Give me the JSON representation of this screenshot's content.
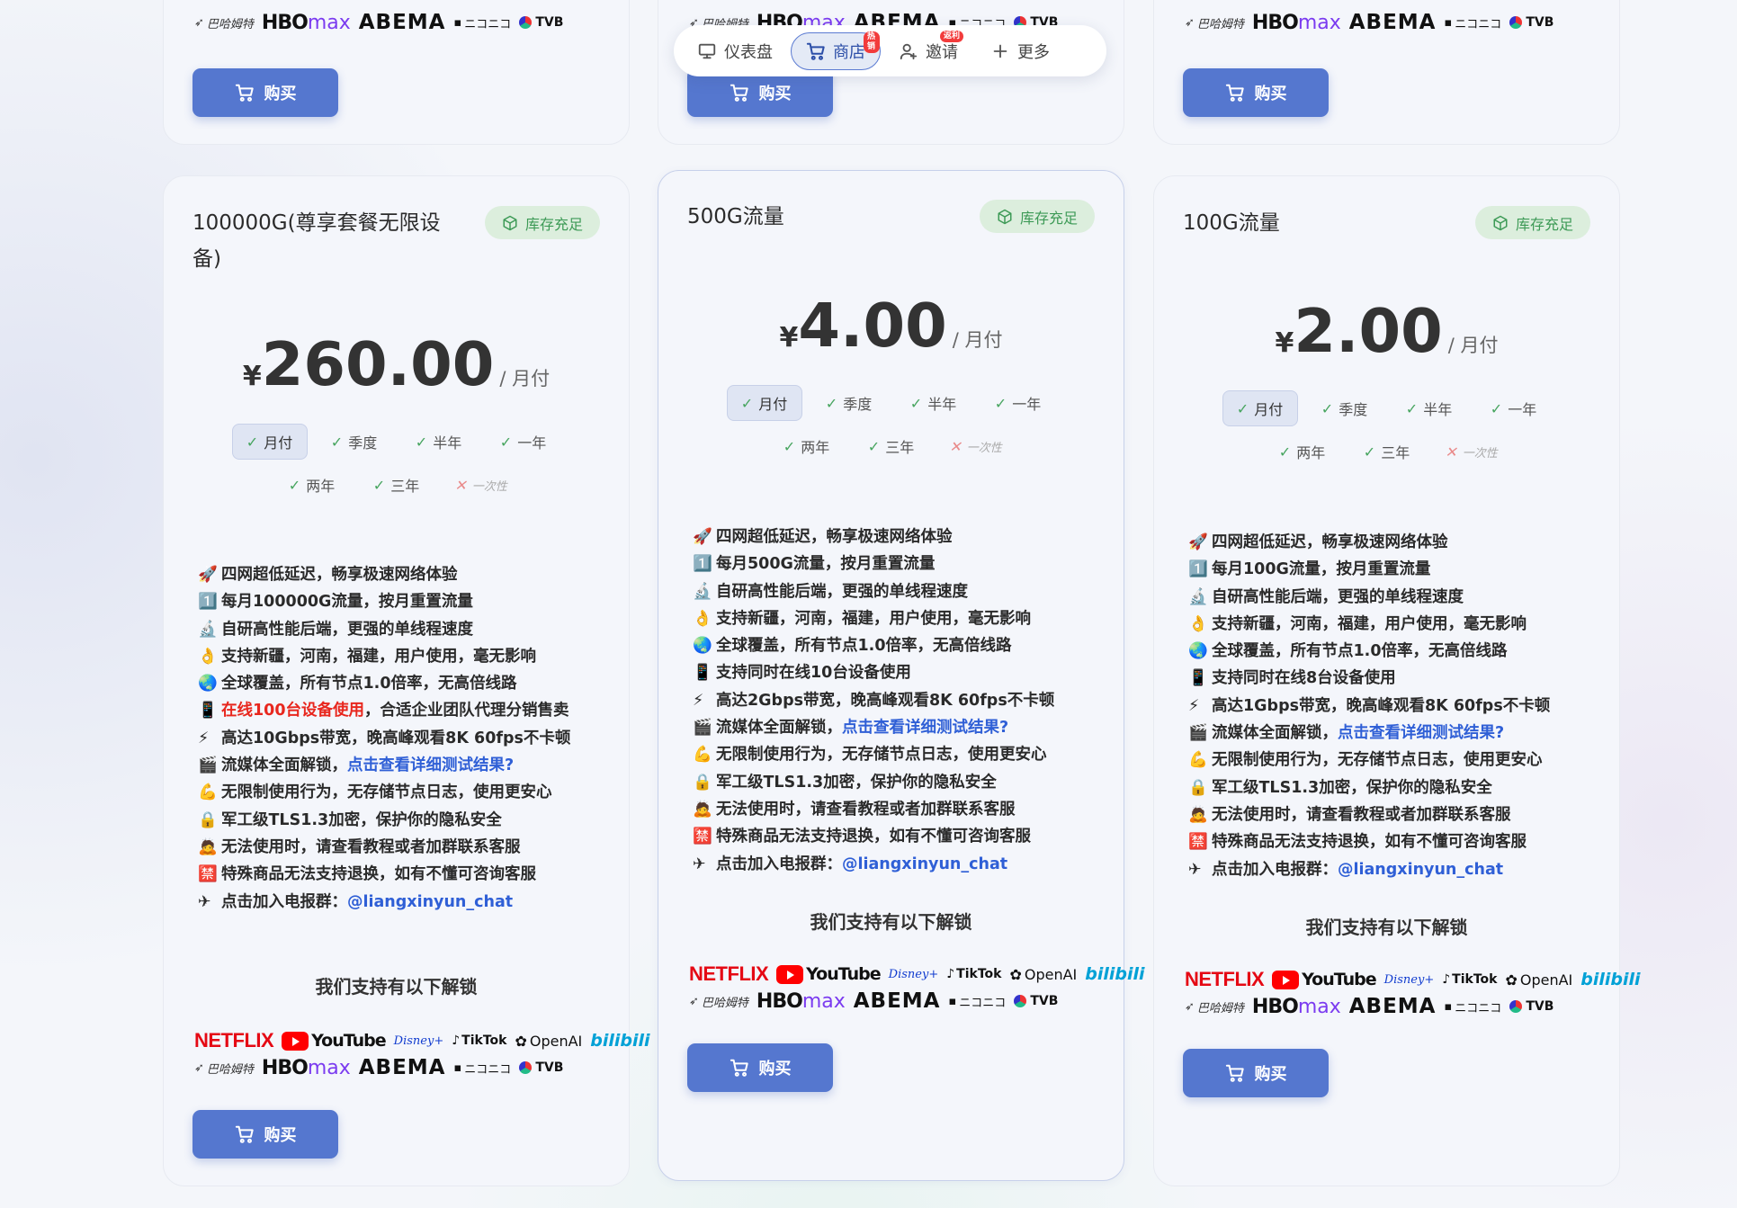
{
  "nav": {
    "items": [
      {
        "label": "仪表盘",
        "icon": "monitor-icon",
        "badge": ""
      },
      {
        "label": "商店",
        "icon": "cart-icon",
        "badge": "热销"
      },
      {
        "label": "邀请",
        "icon": "user-add-icon",
        "badge": "返利"
      },
      {
        "label": "更多",
        "icon": "plus-icon",
        "badge": ""
      }
    ],
    "active": "商店"
  },
  "common": {
    "buy_label": "购买",
    "unlock_title": "我们支持有以下解锁",
    "stock_label": "库存充足",
    "price_currency": "¥",
    "price_period": "/ 月付",
    "cycles": [
      {
        "label": "月付",
        "available": true,
        "selected": true
      },
      {
        "label": "季度",
        "available": true
      },
      {
        "label": "半年",
        "available": true
      },
      {
        "label": "一年",
        "available": true
      },
      {
        "label": "两年",
        "available": true
      },
      {
        "label": "三年",
        "available": true
      },
      {
        "label": "一次性",
        "available": false
      }
    ],
    "logos": {
      "netflix": "NETFLIX",
      "youtube": "YouTube",
      "disney": "Disney+",
      "tiktok": "TikTok",
      "openai": "OpenAI",
      "bilibili": "bilibili",
      "bahamut": "巴哈姆特",
      "hbo": "HBO",
      "max": "max",
      "abema": "ABEMA",
      "niconico": "ニコニコ",
      "tvb": "TVB"
    }
  },
  "plans": [
    {
      "title": "100000G(尊享套餐无限设备)",
      "price": "260.00",
      "features": [
        {
          "icon": "🚀",
          "text": "四网超低延迟，畅享极速网络体验"
        },
        {
          "icon": "1️⃣",
          "text": "每月100000G流量，按月重置流量"
        },
        {
          "icon": "🔬",
          "text": "自研高性能后端，更强的单线程速度"
        },
        {
          "icon": "👌",
          "text": "支持新疆，河南，福建，用户使用，毫无影响"
        },
        {
          "icon": "🌏",
          "text": "全球覆盖，所有节点1.0倍率，无高倍线路"
        },
        {
          "icon": "📱",
          "red": "在线100台设备使用",
          "text": "，合适企业团队代理分销售卖"
        },
        {
          "icon": "⚡",
          "text": "高达10Gbps带宽，晚高峰观看8K 60fps不卡顿"
        },
        {
          "icon": "🎬",
          "text": "流媒体全面解锁，",
          "link": "点击查看详细测试结果?"
        },
        {
          "icon": "💪",
          "text": "无限制使用行为，无存储节点日志，使用更安心"
        },
        {
          "icon": "🔒",
          "text": "军工级TLS1.3加密，保护你的隐私安全"
        },
        {
          "icon": "🙇",
          "text": "无法使用时，请查看教程或者加群联系客服"
        },
        {
          "icon": "🈲",
          "text": "特殊商品无法支持退换，如有不懂可咨询客服"
        },
        {
          "icon": "✈",
          "text": "点击加入电报群：",
          "link": "@liangxinyun_chat"
        }
      ]
    },
    {
      "title": "500G流量",
      "price": "4.00",
      "features": [
        {
          "icon": "🚀",
          "text": "四网超低延迟，畅享极速网络体验"
        },
        {
          "icon": "1️⃣",
          "text": "每月500G流量，按月重置流量"
        },
        {
          "icon": "🔬",
          "text": "自研高性能后端，更强的单线程速度"
        },
        {
          "icon": "👌",
          "text": "支持新疆，河南，福建，用户使用，毫无影响"
        },
        {
          "icon": "🌏",
          "text": "全球覆盖，所有节点1.0倍率，无高倍线路"
        },
        {
          "icon": "📱",
          "text": "支持同时在线10台设备使用"
        },
        {
          "icon": "⚡",
          "text": "高达2Gbps带宽，晚高峰观看8K 60fps不卡顿"
        },
        {
          "icon": "🎬",
          "text": "流媒体全面解锁，",
          "link": "点击查看详细测试结果?"
        },
        {
          "icon": "💪",
          "text": "无限制使用行为，无存储节点日志，使用更安心"
        },
        {
          "icon": "🔒",
          "text": "军工级TLS1.3加密，保护你的隐私安全"
        },
        {
          "icon": "🙇",
          "text": "无法使用时，请查看教程或者加群联系客服"
        },
        {
          "icon": "🈲",
          "text": "特殊商品无法支持退换，如有不懂可咨询客服"
        },
        {
          "icon": "✈",
          "text": "点击加入电报群：",
          "link": "@liangxinyun_chat"
        }
      ]
    },
    {
      "title": "100G流量",
      "price": "2.00",
      "features": [
        {
          "icon": "🚀",
          "text": "四网超低延迟，畅享极速网络体验"
        },
        {
          "icon": "1️⃣",
          "text": "每月100G流量，按月重置流量"
        },
        {
          "icon": "🔬",
          "text": "自研高性能后端，更强的单线程速度"
        },
        {
          "icon": "👌",
          "text": "支持新疆，河南，福建，用户使用，毫无影响"
        },
        {
          "icon": "🌏",
          "text": "全球覆盖，所有节点1.0倍率，无高倍线路"
        },
        {
          "icon": "📱",
          "text": "支持同时在线8台设备使用"
        },
        {
          "icon": "⚡",
          "text": "高达1Gbps带宽，晚高峰观看8K 60fps不卡顿"
        },
        {
          "icon": "🎬",
          "text": "流媒体全面解锁，",
          "link": "点击查看详细测试结果?"
        },
        {
          "icon": "💪",
          "text": "无限制使用行为，无存储节点日志，使用更安心"
        },
        {
          "icon": "🔒",
          "text": "军工级TLS1.3加密，保护你的隐私安全"
        },
        {
          "icon": "🙇",
          "text": "无法使用时，请查看教程或者加群联系客服"
        },
        {
          "icon": "🈲",
          "text": "特殊商品无法支持退换，如有不懂可咨询客服"
        },
        {
          "icon": "✈",
          "text": "点击加入电报群：",
          "link": "@liangxinyun_chat"
        }
      ]
    }
  ],
  "colors": {
    "accent": "#5577cf",
    "stock_bg": "#dceedd",
    "stock_text": "#3d9a56",
    "highlight_red": "#e8271e",
    "link": "#2f5fd6"
  }
}
